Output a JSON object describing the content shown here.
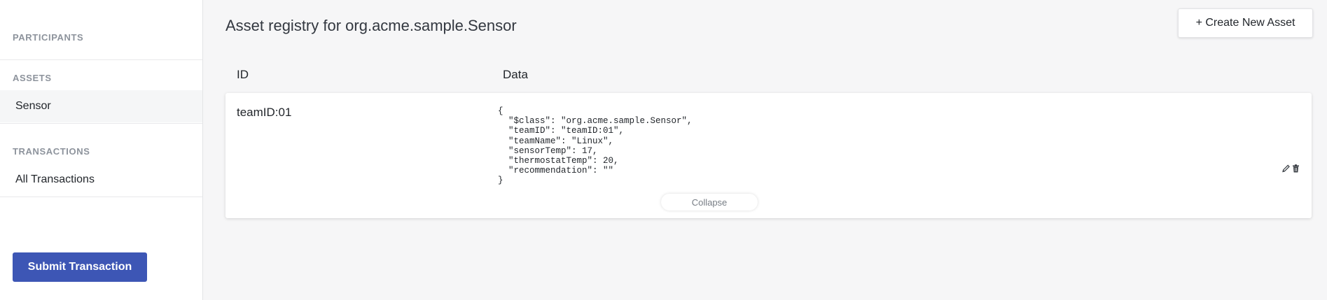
{
  "sidebar": {
    "participants_heading": "PARTICIPANTS",
    "assets_heading": "ASSETS",
    "assets_items": [
      {
        "label": "Sensor"
      }
    ],
    "transactions_heading": "TRANSACTIONS",
    "transactions_items": [
      {
        "label": "All Transactions"
      }
    ],
    "submit_label": "Submit Transaction"
  },
  "main": {
    "title": "Asset registry for org.acme.sample.Sensor",
    "create_label": "+ Create New Asset",
    "columns": {
      "id": "ID",
      "data": "Data"
    },
    "rows": [
      {
        "id": "teamID:01",
        "data": "{\n  \"$class\": \"org.acme.sample.Sensor\",\n  \"teamID\": \"teamID:01\",\n  \"teamName\": \"Linux\",\n  \"sensorTemp\": 17,\n  \"thermostatTemp\": 20,\n  \"recommendation\": \"\"\n}",
        "collapse_label": "Collapse"
      }
    ]
  },
  "colors": {
    "primary": "#3d56b5",
    "background": "#f6f6f7",
    "muted_heading": "#8d939c"
  },
  "icons": {
    "edit": "pencil-icon",
    "delete": "trash-icon"
  }
}
